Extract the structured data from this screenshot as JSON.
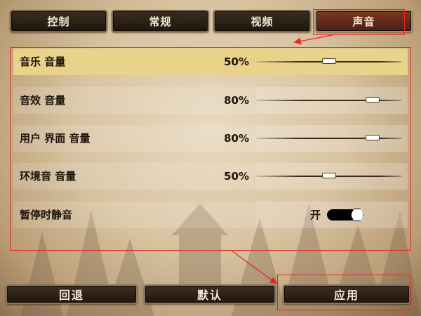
{
  "tabs": [
    {
      "label": "控制",
      "active": false
    },
    {
      "label": "常规",
      "active": false
    },
    {
      "label": "视频",
      "active": false
    },
    {
      "label": "声音",
      "active": true
    }
  ],
  "settings": {
    "music_volume": {
      "label": "音乐 音量",
      "value": "50%",
      "level": 0.5
    },
    "effects_volume": {
      "label": "音效 音量",
      "value": "80%",
      "level": 0.8
    },
    "ui_volume": {
      "label": "用户 界面 音量",
      "value": "80%",
      "level": 0.8
    },
    "ambient_volume": {
      "label": "环境音 音量",
      "value": "50%",
      "level": 0.5
    },
    "mute_on_pause": {
      "label": "暂停时静音",
      "state_label": "开",
      "on": true
    }
  },
  "buttons": {
    "back": "回退",
    "defaults": "默认",
    "apply": "应用"
  },
  "colors": {
    "selected_row": "#e9d28a",
    "active_tab": "#7c3a22",
    "annotation": "#e8271f"
  }
}
